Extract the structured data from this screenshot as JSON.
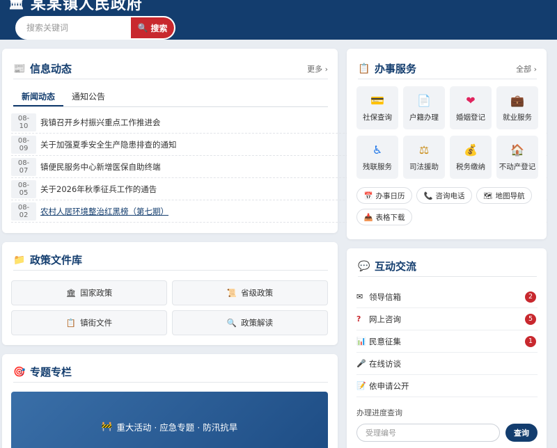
{
  "header": {
    "site_title": "某某镇人民政府",
    "logo_icon": "bank-building-icon",
    "search": {
      "placeholder": "搜索关键词",
      "button_label": "搜索",
      "button_icon": "magnifier-icon"
    }
  },
  "colors": {
    "primary": "#133d6e",
    "accent": "#c8282e",
    "background": "#e9edf2"
  },
  "news": {
    "title": "信息动态",
    "more": "更多",
    "tabs": [
      {
        "label": "新闻动态",
        "active": true
      },
      {
        "label": "通知公告",
        "active": false
      }
    ],
    "items": [
      {
        "date": "08-10",
        "title": "我镇召开乡村振兴重点工作推进会"
      },
      {
        "date": "08-09",
        "title": "关于加强夏季安全生产隐患排查的通知"
      },
      {
        "date": "08-07",
        "title": "镇便民服务中心新增医保自助终端"
      },
      {
        "date": "08-05",
        "title": "关于2026年秋季征兵工作的通告"
      },
      {
        "date": "08-02",
        "title": "农村人居环境整治红黑榜（第七期）"
      }
    ]
  },
  "policy": {
    "title": "政策文件库",
    "items": [
      {
        "label": "国家政策",
        "icon": "bank-building-icon"
      },
      {
        "label": "省级政策",
        "icon": "scroll-icon"
      },
      {
        "label": "镇街文件",
        "icon": "clipboard-icon"
      },
      {
        "label": "政策解读",
        "icon": "magnifier-icon"
      }
    ]
  },
  "special": {
    "title": "专题专栏",
    "banner_text": "重大活动 · 应急专题 · 防汛抗旱"
  },
  "services": {
    "title": "办事服务",
    "more": "全部",
    "items": [
      {
        "label": "社保查询",
        "icon": "id-card-icon"
      },
      {
        "label": "户籍办理",
        "icon": "document-icon"
      },
      {
        "label": "婚姻登记",
        "icon": "heart-icon"
      },
      {
        "label": "就业服务",
        "icon": "briefcase-icon"
      },
      {
        "label": "残联服务",
        "icon": "wheelchair-icon"
      },
      {
        "label": "司法援助",
        "icon": "scales-icon"
      },
      {
        "label": "税务缴纳",
        "icon": "money-bag-icon"
      },
      {
        "label": "不动产登记",
        "icon": "house-icon"
      }
    ],
    "quick_links": [
      {
        "label": "办事日历",
        "icon": "calendar-icon"
      },
      {
        "label": "咨询电话",
        "icon": "phone-icon"
      },
      {
        "label": "地图导航",
        "icon": "map-icon"
      },
      {
        "label": "表格下载",
        "icon": "download-icon"
      }
    ]
  },
  "interaction": {
    "title": "互动交流",
    "items": [
      {
        "label": "领导信箱",
        "icon": "envelope-icon",
        "badge": "2"
      },
      {
        "label": "网上咨询",
        "icon": "question-icon",
        "badge": "5"
      },
      {
        "label": "民意征集",
        "icon": "bar-chart-icon",
        "badge": "1"
      },
      {
        "label": "在线访谈",
        "icon": "microphone-icon",
        "badge": ""
      },
      {
        "label": "依申请公开",
        "icon": "pencil-doc-icon",
        "badge": ""
      }
    ],
    "progress": {
      "label": "办理进度查询",
      "placeholder": "受理编号",
      "button_label": "查询"
    }
  }
}
